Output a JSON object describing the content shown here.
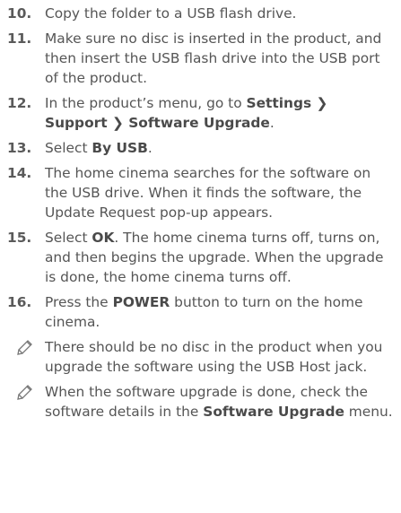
{
  "steps": [
    {
      "num": "10.",
      "parts": [
        {
          "t": "Copy the folder to a USB flash drive."
        }
      ]
    },
    {
      "num": "11.",
      "parts": [
        {
          "t": "Make sure no disc is inserted in the product, and then insert the USB flash drive into the USB port of the product."
        }
      ]
    },
    {
      "num": "12.",
      "parts": [
        {
          "t": "In the product’s menu, go to "
        },
        {
          "t": "Settings ❯ Support ❯ Software Upgrade",
          "b": true
        },
        {
          "t": "."
        }
      ]
    },
    {
      "num": "13.",
      "parts": [
        {
          "t": "Select "
        },
        {
          "t": "By USB",
          "b": true
        },
        {
          "t": "."
        }
      ]
    },
    {
      "num": "14.",
      "parts": [
        {
          "t": "The home cinema searches for the software on the USB drive. When it finds the software, the Update Request pop-up appears."
        }
      ]
    },
    {
      "num": "15.",
      "parts": [
        {
          "t": "Select "
        },
        {
          "t": "OK",
          "b": true
        },
        {
          "t": ". The home cinema turns off, turns on, and then begins the upgrade. When the upgrade is done, the home cinema turns off."
        }
      ]
    },
    {
      "num": "16.",
      "parts": [
        {
          "t": "Press the "
        },
        {
          "t": "POWER",
          "b": true
        },
        {
          "t": " button to turn on the home cinema."
        }
      ]
    }
  ],
  "notes": [
    {
      "icon": "pencil-note-icon",
      "parts": [
        {
          "t": "There should be no disc in the product when you upgrade the software using the USB Host jack."
        }
      ]
    },
    {
      "icon": "pencil-note-icon",
      "parts": [
        {
          "t": "When the software upgrade is done, check the software details in the "
        },
        {
          "t": "Software Upgrade",
          "b": true
        },
        {
          "t": " menu."
        }
      ]
    }
  ]
}
